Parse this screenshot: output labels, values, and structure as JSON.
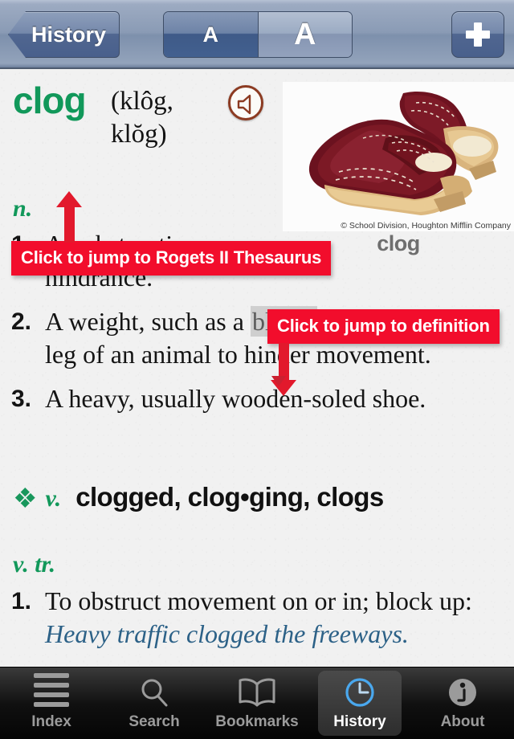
{
  "toolbar": {
    "back_label": "History",
    "back_icon": "chevron-left-icon",
    "text_size_small_label": "A",
    "text_size_large_label": "A",
    "add_label": "+",
    "add_icon": "plus-icon"
  },
  "entry": {
    "headword": "clog",
    "pronunciation": "(klôg, klŏg)",
    "audio_icon": "speaker-icon",
    "headword_color": "#11985a",
    "noun": {
      "pos_label": "n.",
      "senses": [
        {
          "num": "1.",
          "text": "An obstruction or hindrance."
        },
        {
          "num": "2.",
          "pre": "A weight, such as a ",
          "xref": "block,",
          "post": " attached to the leg of an animal to hinder movement."
        },
        {
          "num": "3.",
          "text": "A heavy, usually wooden-soled shoe."
        }
      ]
    },
    "verb": {
      "diamond_icon": "diamond-cluster-icon",
      "diamond_glyph": "❖",
      "pos_label": "v.",
      "inflections": "clogged, clog•ging, clogs",
      "transitive": {
        "pos_label": "v. tr.",
        "senses": [
          {
            "num": "1.",
            "text": "To obstruct movement on or in; block up: ",
            "example": "Heavy traffic clogged the freeways."
          }
        ]
      }
    }
  },
  "figure": {
    "caption": "clog",
    "credit": "© School Division, Houghton Mifflin Company",
    "alt": "pair of burgundy leather clogs with wooden soles"
  },
  "annotations": [
    {
      "id": "thesaurus",
      "label": "Click to jump to Rogets II Thesaurus",
      "direction": "up",
      "color": "#f20d2c"
    },
    {
      "id": "definition",
      "label": "Click to jump to definition",
      "direction": "down",
      "color": "#f20d2c"
    }
  ],
  "tabbar": {
    "active": "History",
    "tabs": [
      {
        "label": "Index",
        "icon": "hamburger-icon"
      },
      {
        "label": "Search",
        "icon": "magnifier-icon"
      },
      {
        "label": "Bookmarks",
        "icon": "open-book-icon"
      },
      {
        "label": "History",
        "icon": "clock-icon"
      },
      {
        "label": "About",
        "icon": "info-circle-icon"
      }
    ]
  }
}
